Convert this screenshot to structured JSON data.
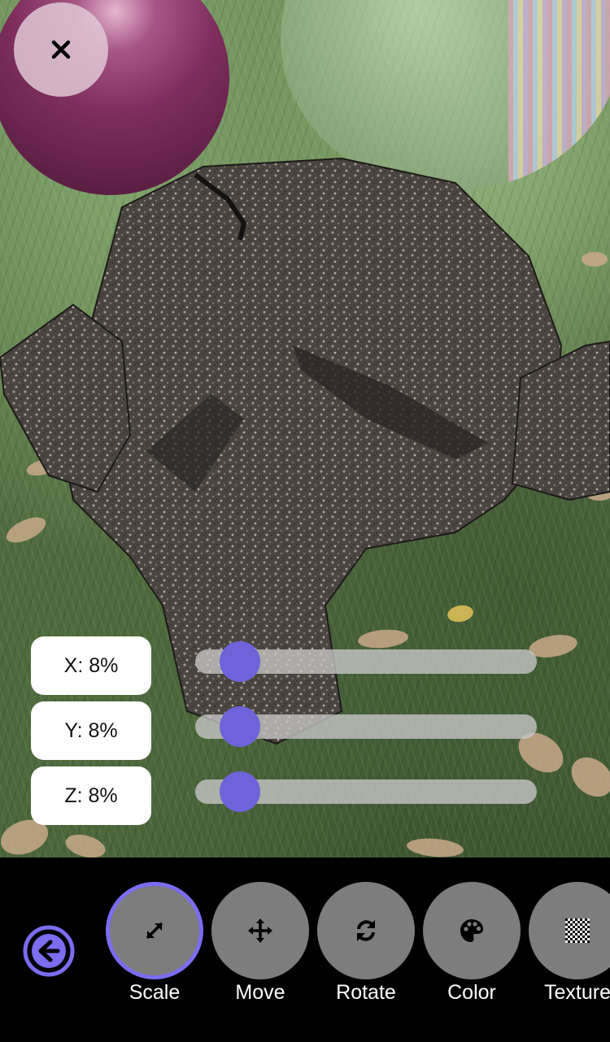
{
  "scene": {
    "close_icon": "close-icon"
  },
  "axes": [
    {
      "label": "X: 8%",
      "value_percent": 8
    },
    {
      "label": "Y: 8%",
      "value_percent": 8
    },
    {
      "label": "Z: 8%",
      "value_percent": 8
    }
  ],
  "toolbar": {
    "back_icon": "arrow-left-circle-icon",
    "tools": [
      {
        "label": "Scale",
        "icon": "resize-diagonal-icon",
        "active": true
      },
      {
        "label": "Move",
        "icon": "move-arrows-icon",
        "active": false
      },
      {
        "label": "Rotate",
        "icon": "rotate-sync-icon",
        "active": false
      },
      {
        "label": "Color",
        "icon": "palette-icon",
        "active": false
      },
      {
        "label": "Texture",
        "icon": "checkerboard-icon",
        "active": false
      }
    ]
  },
  "colors": {
    "accent": "#7b6cf0",
    "slider_thumb": "#6f63d9",
    "tool_button": "#7d7d7d",
    "toolbar_bg": "#000000"
  }
}
